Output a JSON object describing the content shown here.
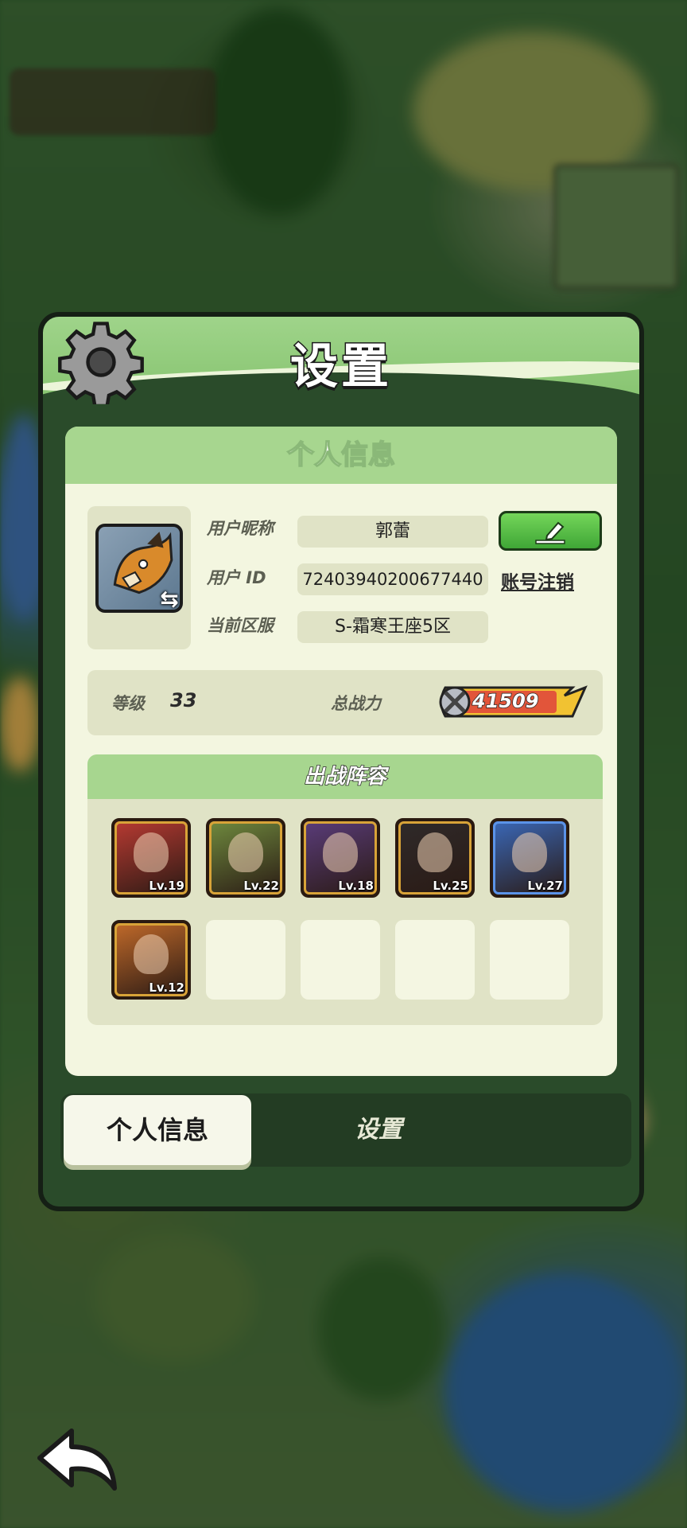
{
  "dialog": {
    "title": "设置",
    "section_title": "个人信息"
  },
  "profile": {
    "nickname_label": "用户昵称",
    "nickname": "郭蕾",
    "id_label": "用户 ID",
    "user_id": "72403940200677440",
    "server_label": "当前区服",
    "server": "S-霜寒王座5区",
    "cancel_account": "账号注销"
  },
  "stats": {
    "level_label": "等级",
    "level": "33",
    "power_label": "总战力",
    "power": "41509"
  },
  "lineup": {
    "title": "出战阵容",
    "heroes": [
      {
        "level": "Lv.19",
        "frame": "gold",
        "color": "#b83a32"
      },
      {
        "level": "Lv.22",
        "frame": "gold",
        "color": "#6f8a3e"
      },
      {
        "level": "Lv.18",
        "frame": "gold",
        "color": "#5a3c7a"
      },
      {
        "level": "Lv.25",
        "frame": "gold",
        "color": "#2f2a2a"
      },
      {
        "level": "Lv.27",
        "frame": "blue",
        "color": "#3a68b8"
      },
      {
        "level": "Lv.12",
        "frame": "gold",
        "color": "#c16a2a"
      }
    ]
  },
  "tabs": {
    "profile": "个人信息",
    "settings": "设置"
  },
  "colors": {
    "header_green": "#9fd48a",
    "panel_dark": "#2a4b2a",
    "button_green": "#4fb83f",
    "power_red": "#e2553a",
    "power_yellow": "#f1c232"
  }
}
